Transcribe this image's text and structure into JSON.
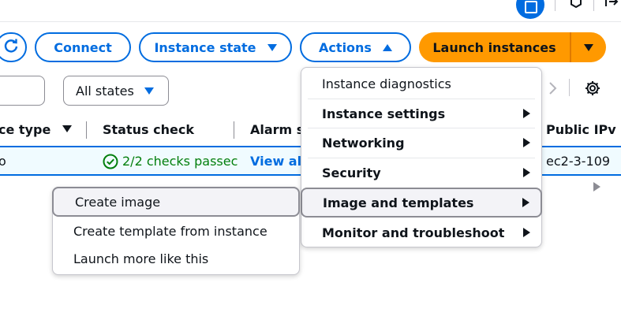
{
  "toolbar": {
    "connect_label": "Connect",
    "instance_state_label": "Instance state",
    "actions_label": "Actions",
    "launch_label": "Launch instances"
  },
  "filter": {
    "states_value": "All states"
  },
  "table": {
    "columns": [
      "ce type",
      "Status check",
      "Alarm s",
      "Public IPv"
    ],
    "row": {
      "type_fragment": "o",
      "status": "2/2 checks passec",
      "alarm_link": "View ala",
      "public_dns": "ec2-3-109"
    }
  },
  "actions_menu": {
    "items": [
      {
        "label": "Instance diagnostics",
        "submenu": false
      },
      {
        "label": "Instance settings",
        "submenu": true
      },
      {
        "label": "Networking",
        "submenu": true
      },
      {
        "label": "Security",
        "submenu": true
      },
      {
        "label": "Image and templates",
        "submenu": true
      },
      {
        "label": "Monitor and troubleshoot",
        "submenu": true
      }
    ]
  },
  "submenu": {
    "items": [
      {
        "label": "Create image"
      },
      {
        "label": "Create template from instance"
      },
      {
        "label": "Launch more like this"
      }
    ]
  },
  "colors": {
    "primary": "#006ce0",
    "accent": "#ff9900",
    "success": "#037f0c"
  }
}
